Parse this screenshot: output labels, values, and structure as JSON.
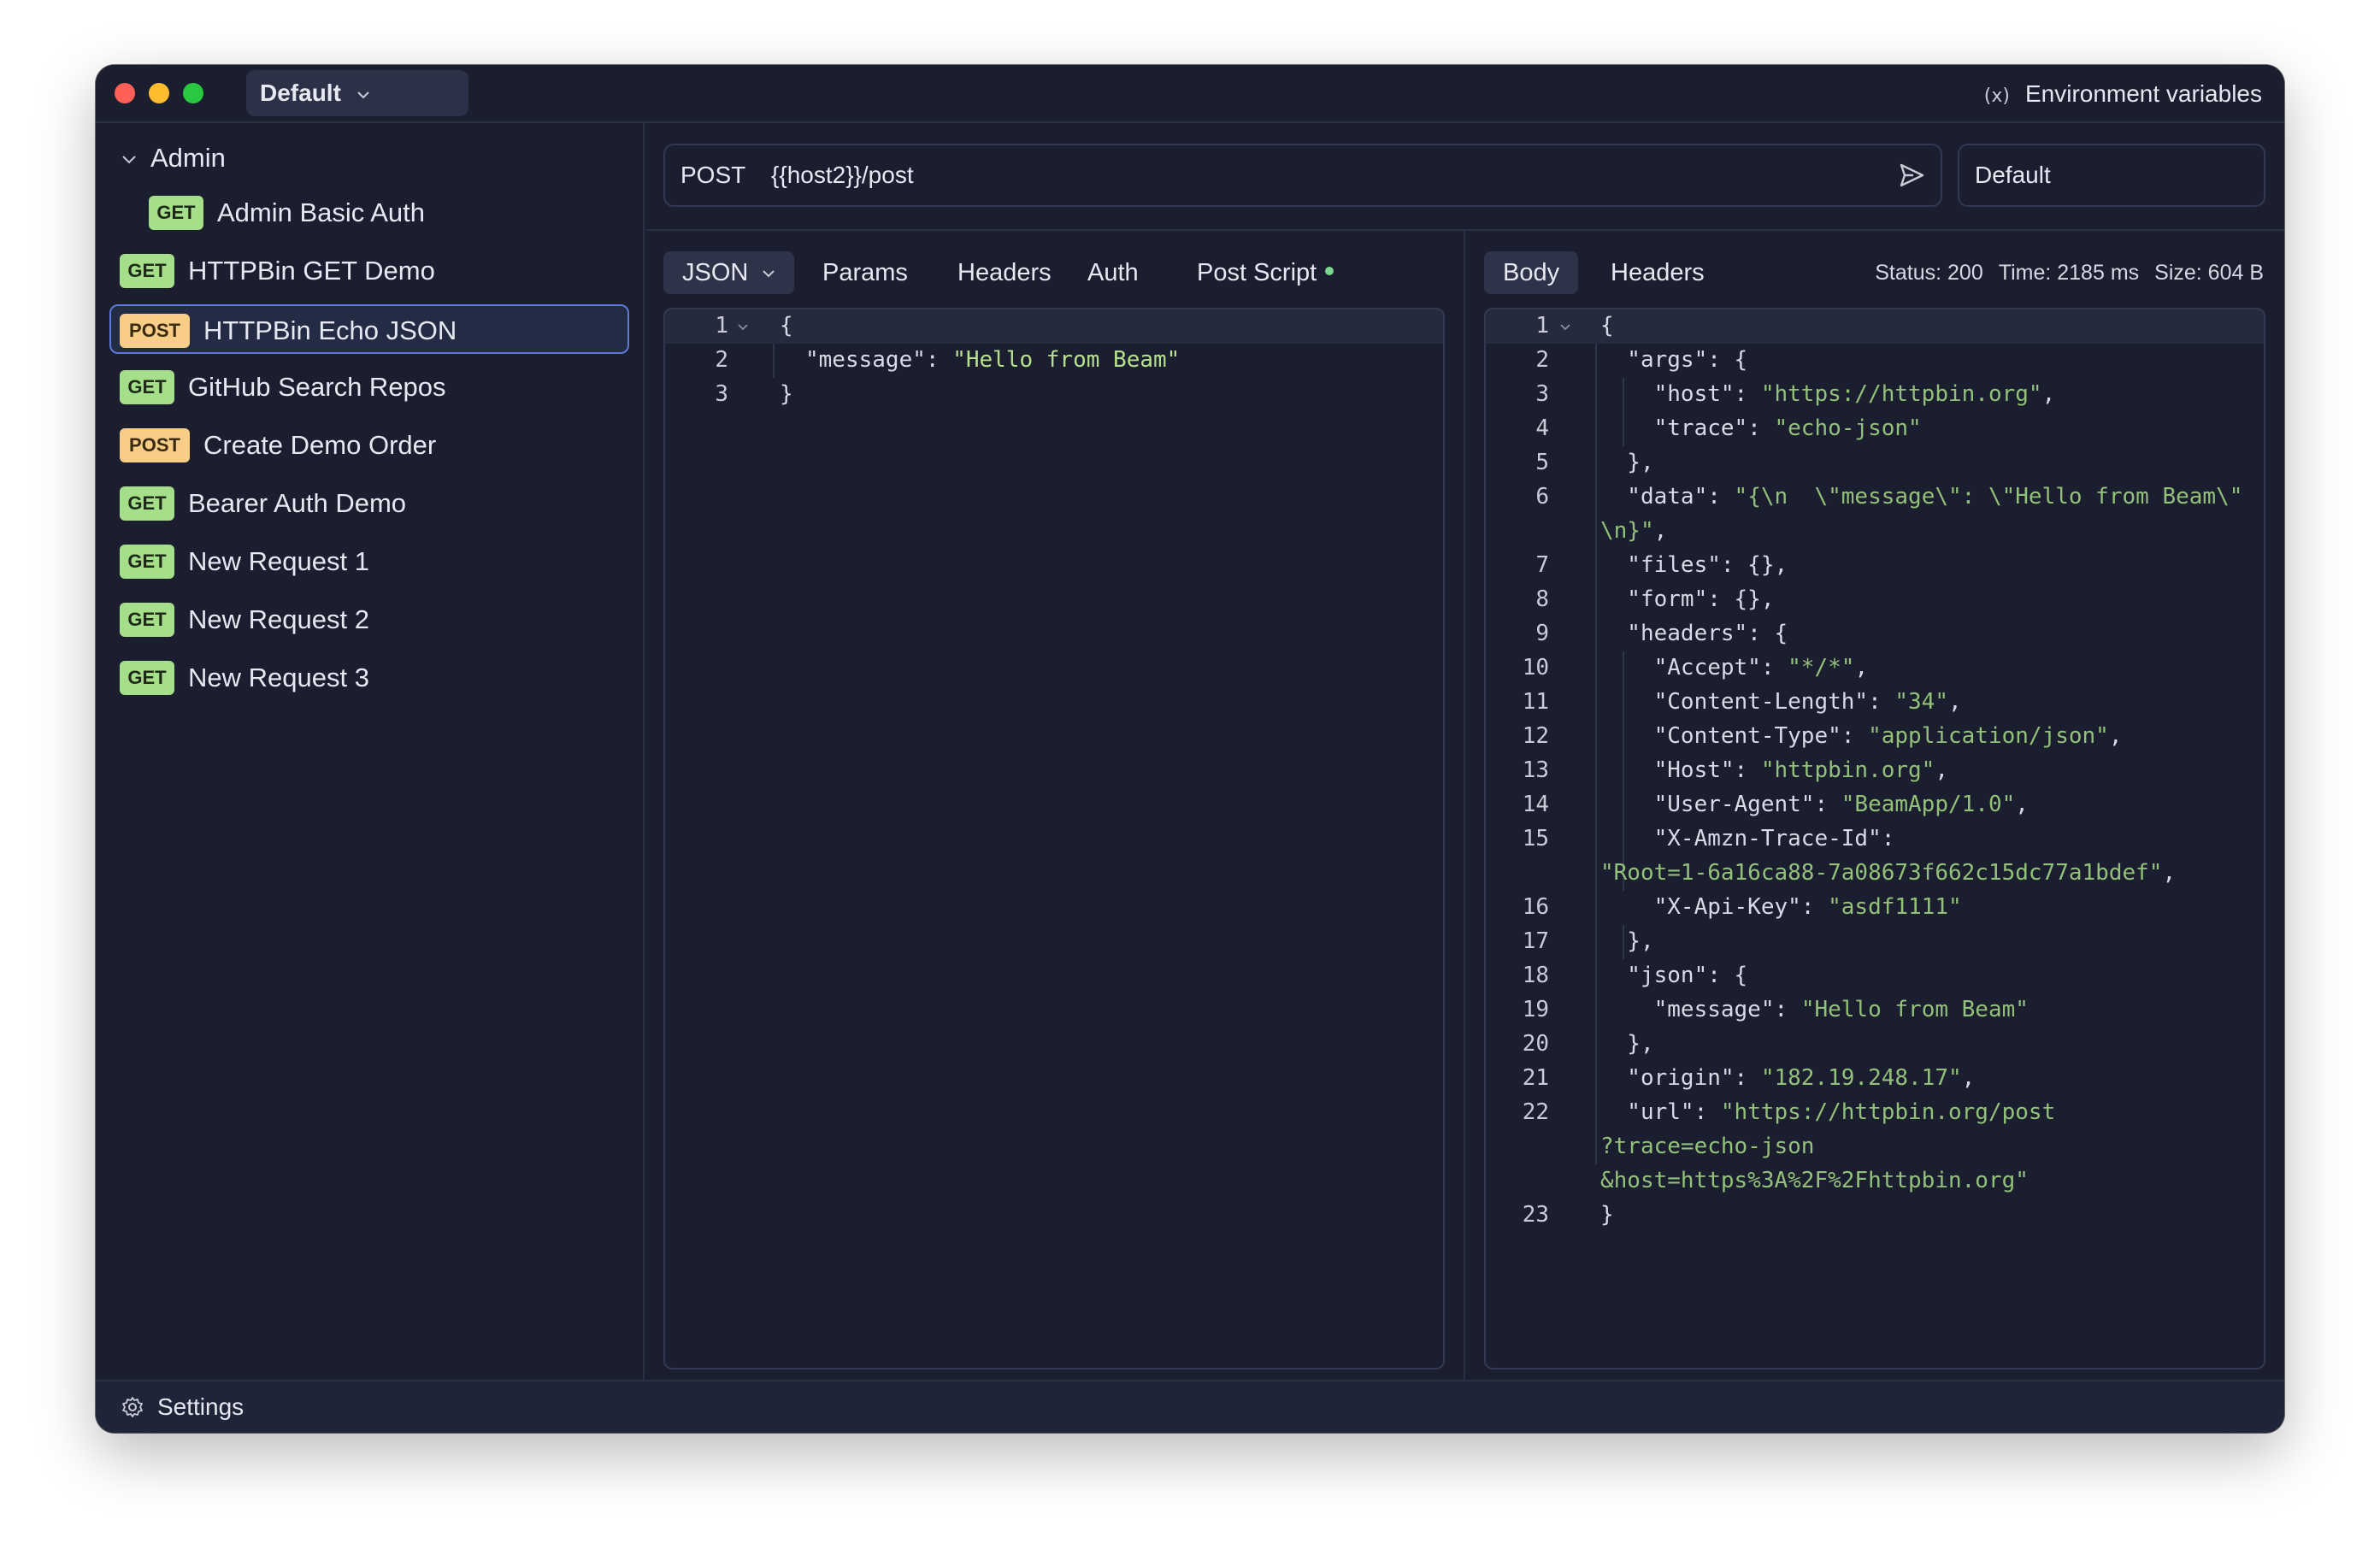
{
  "titlebar": {
    "workspace": "Default",
    "env_vars_icon": "(x)",
    "env_vars_label": "Environment variables"
  },
  "sidebar": {
    "folder": "Admin",
    "items": [
      {
        "method": "GET",
        "label": "Admin Basic Auth"
      },
      {
        "method": "GET",
        "label": "HTTPBin GET Demo"
      },
      {
        "method": "POST",
        "label": "HTTPBin Echo JSON",
        "active": true
      },
      {
        "method": "GET",
        "label": "GitHub Search Repos"
      },
      {
        "method": "POST",
        "label": "Create Demo Order"
      },
      {
        "method": "GET",
        "label": "Bearer Auth Demo"
      },
      {
        "method": "GET",
        "label": "New Request 1"
      },
      {
        "method": "GET",
        "label": "New Request 2"
      },
      {
        "method": "GET",
        "label": "New Request 3"
      }
    ],
    "settings_label": "Settings"
  },
  "request": {
    "method": "POST",
    "url": "{{host2}}/post",
    "environment": "Default",
    "tabs": [
      "JSON",
      "Params",
      "Headers",
      "Auth",
      "Post Script"
    ],
    "body_lines": [
      {
        "n": "1",
        "text": "{"
      },
      {
        "n": "2",
        "key": "\"message\"",
        "sep": ": ",
        "str": "\"Hello from Beam\""
      },
      {
        "n": "3",
        "text": "}"
      }
    ]
  },
  "response": {
    "tabs": [
      "Body",
      "Headers"
    ],
    "status": "Status: 200",
    "time": "Time: 2185 ms",
    "size": "Size: 604 B",
    "lines": [
      {
        "n": "1",
        "text": "{"
      },
      {
        "n": "2",
        "text": "  \"args\": {"
      },
      {
        "n": "3",
        "text": "    \"host\": ",
        "str": "\"https://httpbin.org\"",
        "tail": ","
      },
      {
        "n": "4",
        "text": "    \"trace\": ",
        "str": "\"echo-json\""
      },
      {
        "n": "5",
        "text": "  },"
      },
      {
        "n": "6",
        "text": "  \"data\": ",
        "str": "\"{\\n  \\\"message\\\": \\\"Hello from Beam\\\""
      },
      {
        "n": "",
        "str": "\\n}\"",
        "tail": ","
      },
      {
        "n": "7",
        "text": "  \"files\": {},"
      },
      {
        "n": "8",
        "text": "  \"form\": {},"
      },
      {
        "n": "9",
        "text": "  \"headers\": {"
      },
      {
        "n": "10",
        "text": "    \"Accept\": ",
        "str": "\"*/*\"",
        "tail": ","
      },
      {
        "n": "11",
        "text": "    \"Content-Length\": ",
        "str": "\"34\"",
        "tail": ","
      },
      {
        "n": "12",
        "text": "    \"Content-Type\": ",
        "str": "\"application/json\"",
        "tail": ","
      },
      {
        "n": "13",
        "text": "    \"Host\": ",
        "str": "\"httpbin.org\"",
        "tail": ","
      },
      {
        "n": "14",
        "text": "    \"User-Agent\": ",
        "str": "\"BeamApp/1.0\"",
        "tail": ","
      },
      {
        "n": "15",
        "text": "    \"X-Amzn-Trace-Id\":"
      },
      {
        "n": "",
        "str": "\"Root=1-6a16ca88-7a08673f662c15dc77a1bdef\"",
        "tail": ","
      },
      {
        "n": "16",
        "text": "    \"X-Api-Key\": ",
        "str": "\"asdf1111\""
      },
      {
        "n": "17",
        "text": "  },"
      },
      {
        "n": "18",
        "text": "  \"json\": {"
      },
      {
        "n": "19",
        "text": "    \"message\": ",
        "str": "\"Hello from Beam\""
      },
      {
        "n": "20",
        "text": "  },"
      },
      {
        "n": "21",
        "text": "  \"origin\": ",
        "str": "\"182.19.248.17\"",
        "tail": ","
      },
      {
        "n": "22",
        "text": "  \"url\": ",
        "str": "\"https://httpbin.org/post"
      },
      {
        "n": "",
        "str": "?trace=echo-json"
      },
      {
        "n": "",
        "str": "&host=https%3A%2F%2Fhttpbin.org\""
      },
      {
        "n": "23",
        "text": "}"
      }
    ]
  }
}
